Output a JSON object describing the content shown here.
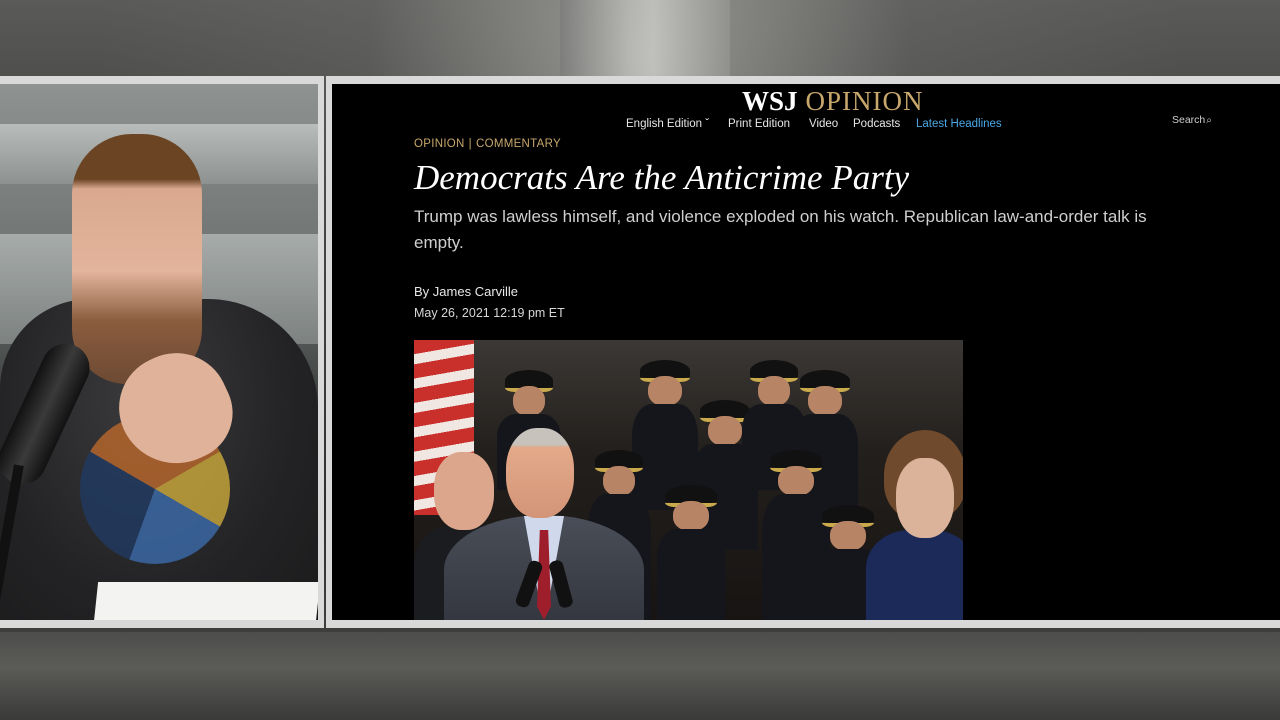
{
  "page": {
    "masthead": {
      "wsj": "WSJ",
      "section": "OPINION"
    },
    "nav": [
      {
        "label": "English Edition ˇ"
      },
      {
        "label": "Print Edition"
      },
      {
        "label": "Video"
      },
      {
        "label": "Podcasts"
      },
      {
        "label": "Latest Headlines"
      }
    ],
    "search_label": "Search",
    "kicker": {
      "section": "OPINION",
      "separator": "|",
      "subsection": "COMMENTARY"
    },
    "headline": "Democrats Are the Anticrime Party",
    "dek": "Trump was lawless himself, and violence exploded on his watch. Republican law-and-order talk is empty.",
    "byline": {
      "prefix": "By",
      "author": "James Carville"
    },
    "date": "May 26, 2021 12:19 pm ET"
  },
  "colors": {
    "accent_gold": "#c7a76c",
    "link_blue": "#4aa8e6",
    "page_bg": "#000000"
  }
}
